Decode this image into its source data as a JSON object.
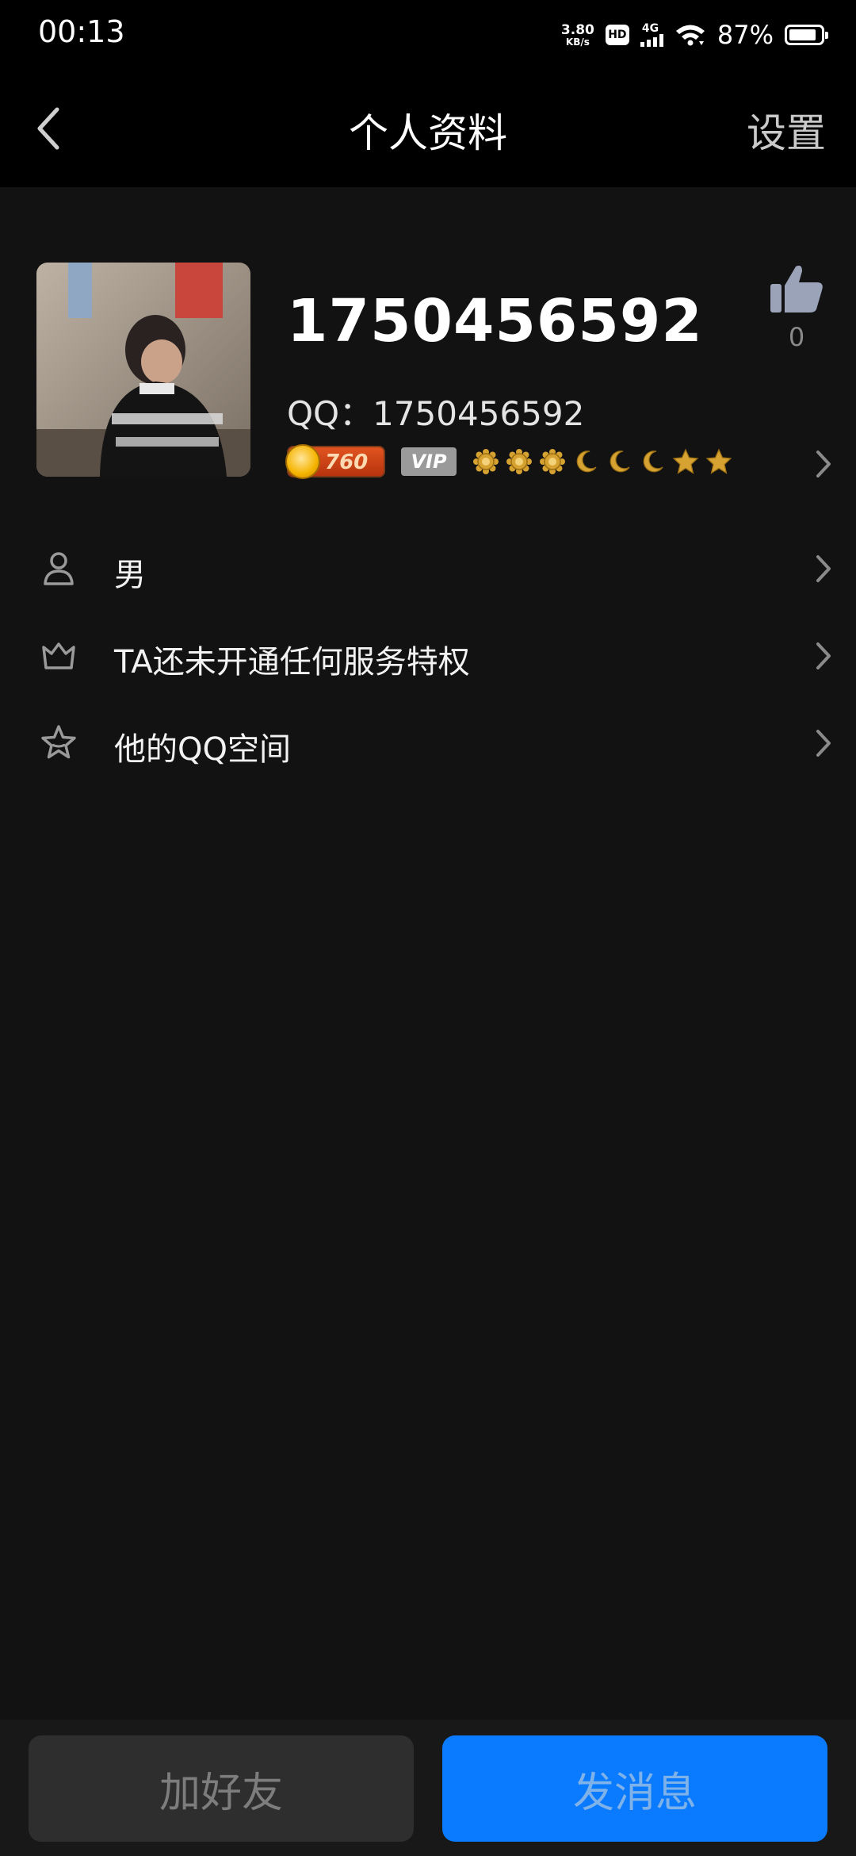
{
  "status_bar": {
    "time": "00:13",
    "net_speed_value": "3.80",
    "net_speed_unit": "KB/s",
    "hd_label": "HD",
    "network_type": "4G",
    "battery_percent": "87%",
    "battery_level": 0.87
  },
  "nav": {
    "title": "个人资料",
    "settings_label": "设置"
  },
  "profile": {
    "nickname": "1750456592",
    "qq_line": "QQ：1750456592",
    "like_count": "0",
    "coin_value": "760",
    "vip_label": "VIP",
    "level_icons": [
      "sun",
      "sun",
      "sun",
      "moon",
      "moon",
      "moon",
      "star",
      "star"
    ]
  },
  "info_list": [
    {
      "icon": "person-icon",
      "label": "男"
    },
    {
      "icon": "crown-icon",
      "label": "TA还未开通任何服务特权"
    },
    {
      "icon": "star-icon",
      "label": "他的QQ空间"
    }
  ],
  "bottom": {
    "add_friend_label": "加好友",
    "send_message_label": "发消息"
  },
  "colors": {
    "background": "#121212",
    "bar_black": "#000000",
    "primary_blue": "#0a7aff",
    "muted_gray": "#8a8a8a"
  }
}
